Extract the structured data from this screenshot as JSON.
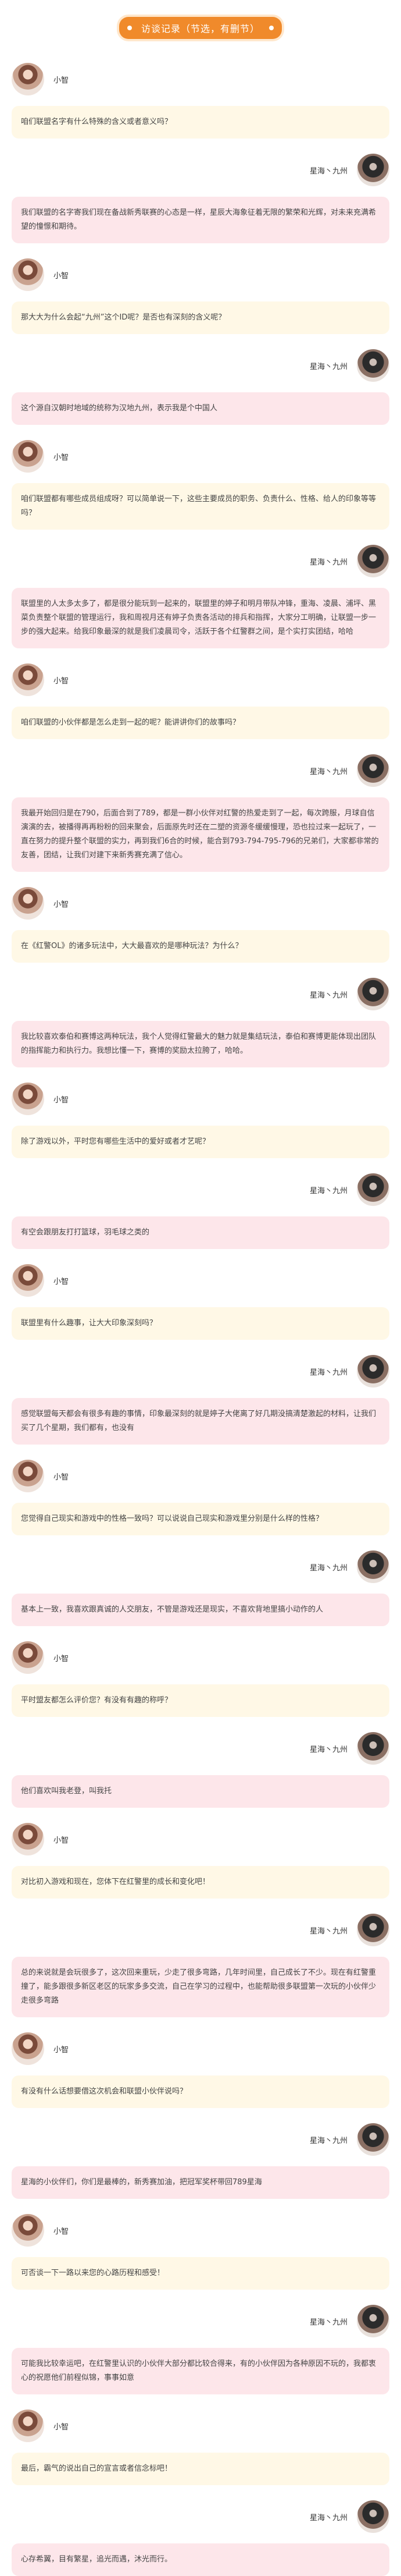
{
  "header": {
    "title": "访谈记录（节选，有删节）"
  },
  "speakers": {
    "interviewer": "小智",
    "interviewee": "星海丶九州"
  },
  "qa": [
    {
      "q": "咱们联盟名字有什么特殊的含义或者意义吗？",
      "a": "我们联盟的名字寄我们现在备战新秀联赛的心态是一样，星辰大海象征着无限的繁荣和光辉，对未来充满希望的憧憬和期待。"
    },
    {
      "q": "那大大为什么会起“九州”这个ID呢？是否也有深刻的含义呢？",
      "a": "这个源自汉朝时地域的统称为汉地九州，表示我是个中国人"
    },
    {
      "q": "咱们联盟都有哪些成员组成呀？可以简单说一下，这些主要成员的职务、负责什么、性格、给人的印象等等吗？",
      "a": "联盟里的人太多太多了，都是很分能玩到一起来的，联盟里的婷子和明月带队冲锋，重海、凌晨、浦坪、黑菜负责整个联盟的管理运行，我和周视月还有婷子负责各活动的排兵和指挥，大家分工明确，让联盟一步一步的强大起来。给我印象最深的就是我们凌晨司令，活跃于各个红警群之间，是个实打实团结，哈哈"
    },
    {
      "q": "咱们联盟的小伙伴都是怎么走到一起的呢？能讲讲你们的故事吗？",
      "a": "我最开始回归是在790，后面合到了789，都是一群小伙伴对红警的热爱走到了一起，每次跨服，月球自信演演的去，被播得再再粉粉的回来聚会，后面原先时还在二塑的资源冬缓缓慢理，恐也拉过来一起玩了，一直在努力的提升整个联盟的实力，再到我们6合的时候，能合到793-794-795-796的兄弟们，大家都非常的友善，团结，让我们对建下来新秀赛充满了信心。"
    },
    {
      "q": "在《红警OL》的诸多玩法中，大大最喜欢的是哪种玩法？为什么？",
      "a": "我比较喜欢泰伯和赛博这两种玩法，我个人觉得红警最大的魅力就是集结玩法，泰伯和赛博更能体现出团队的指挥能力和执行力。我想比懂一下，赛博的奖励太拉胯了，哈哈。"
    },
    {
      "q": "除了游戏以外，平时您有哪些生活中的爱好或者才艺呢？",
      "a": "有空会跟朋友打打篮球，羽毛球之类的"
    },
    {
      "q": "联盟里有什么趣事，让大大印象深刻吗？",
      "a": "感觉联盟每天都会有很多有趣的事情，印象最深刻的就是婷子大佬离了好几期没搞清楚激起的材料，让我们买了几个星期，我们都有，也没有"
    },
    {
      "q": "您觉得自己现实和游戏中的性格一致吗？可以说说自己现实和游戏里分别是什么样的性格？",
      "a": "基本上一致，我喜欢跟真诚的人交朋友，不管是游戏还是现实，不喜欢背地里搞小动作的人"
    },
    {
      "q": "平时盟友都怎么评价您？有没有有趣的称呼？",
      "a": "他们喜欢叫我老登，叫我托"
    },
    {
      "q": "对比初入游戏和现在，您体下在红警里的成长和变化吧！",
      "a": "总的来说就是会玩很多了，这次回来重玩，少走了很多弯路，几年时间里，自己成长了不少。现在有红警重撞了，能多跟很多新区老区的玩家多多交流，自己在学习的过程中，也能帮助很多联盟第一次玩的小伙伴少走很多弯路"
    },
    {
      "q": "有没有什么话想要借这次机会和联盟小伙伴说吗？",
      "a": "星海的小伙伴们，你们是最棒的，新秀赛加油，把冠军奖杯带回789星海"
    },
    {
      "q": "可否谈一下一路以来您的心路历程和感受！",
      "a": "可能我比较幸运吧，在红警里认识的小伙伴大部分都比较合得来，有的小伙伴因为各种原因不玩的，我都衷心的祝愿他们前程似锦，事事如意"
    },
    {
      "q": "最后，霸气的说出自己的宣言或者信念标吧！",
      "a": "心存希翼，目有繁星，追光而遇，沐光而行。"
    }
  ]
}
